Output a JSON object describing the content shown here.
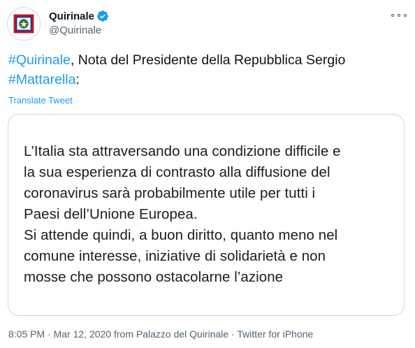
{
  "account": {
    "display_name": "Quirinale",
    "handle": "@Quirinale",
    "icons": {
      "avatar": "italian-presidential-emblem",
      "verified": "verified-badge-icon",
      "more": "more-options-icon"
    }
  },
  "tweet": {
    "hashtag_1": "#Quirinale",
    "text_1": ", Nota del Presidente della Repubblica Sergio",
    "hashtag_2": "#Mattarella",
    "text_2": ":",
    "translate_label": "Translate Tweet"
  },
  "image_card": {
    "lines": [
      "L’Italia sta attraversando una condizione difficile e",
      "la sua esperienza di contrasto alla diffusione del",
      "coronavirus sarà probabilmente utile per tutti i",
      "Paesi dell’Unione Europea.",
      "Si attende quindi, a buon diritto, quanto meno nel",
      "comune interesse, iniziative di solidarietà e non",
      "mosse che possono ostacolarne l’azione"
    ]
  },
  "meta": {
    "time": "8:05 PM",
    "separator": " · ",
    "date": "Mar 12, 2020",
    "from_prefix": " from ",
    "location": "Palazzo del Quirinale",
    "source": "Twitter for iPhone"
  },
  "colors": {
    "link": "#1d9bf0",
    "secondary_text": "#536471",
    "border": "#cfd9de",
    "emblem_red": "#c8102e",
    "emblem_green": "#008c45"
  }
}
